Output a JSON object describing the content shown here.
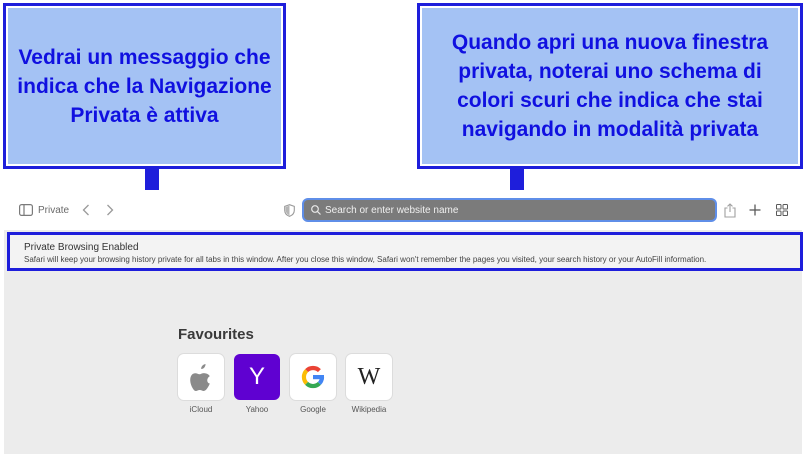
{
  "annotations": {
    "left": "Vedrai un messaggio che indica che la Navigazione Privata è attiva",
    "right": "Quando apri una nuova finestra privata, noterai uno schema di colori scuri che indica che stai navigando in modalità privata"
  },
  "toolbar": {
    "tab_label": "Private",
    "address_placeholder": "Search or enter website name"
  },
  "banner": {
    "title": "Private Browsing Enabled",
    "body": "Safari will keep your browsing history private for all tabs in this window. After you close this window, Safari won't remember the pages you visited, your search history or your AutoFill information."
  },
  "favourites": {
    "title": "Favourites",
    "items": [
      {
        "label": "iCloud",
        "icon": "apple-icon"
      },
      {
        "label": "Yahoo",
        "icon": "Y"
      },
      {
        "label": "Google",
        "icon": "google-icon"
      },
      {
        "label": "Wikipedia",
        "icon": "W"
      }
    ]
  },
  "colors": {
    "callout_bg": "#a4c2f4",
    "callout_border": "#1e1edb",
    "callout_text": "#1010e0",
    "yahoo": "#5f01d1",
    "address_bar": "#7b7b7b"
  }
}
